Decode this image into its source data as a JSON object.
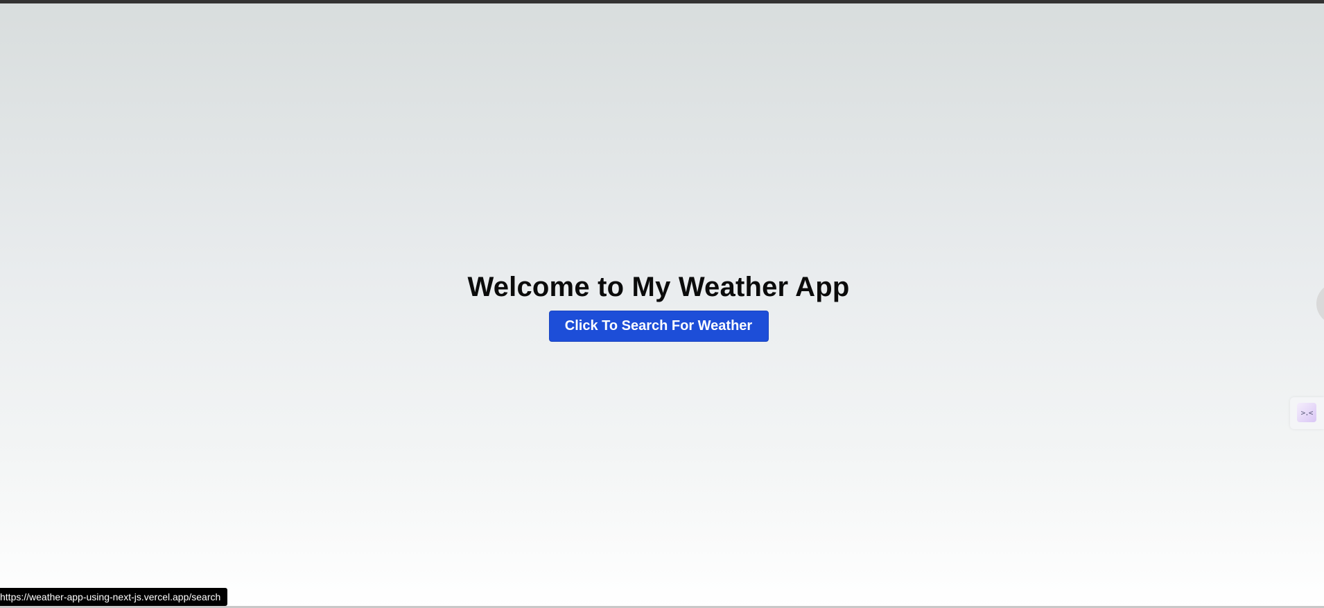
{
  "hero": {
    "title": "Welcome to My Weather App",
    "button_label": "Click To Search For Weather"
  },
  "status_bar": {
    "url": "https://weather-app-using-next-js.vercel.app/search"
  },
  "edge_widget": {
    "glyph": ">.<"
  },
  "colors": {
    "button_bg": "#1d4ed8",
    "title_text": "#0b0b0b",
    "top_bar": "#333333"
  },
  "icons": {
    "edge_widget_icon": "extension-face-icon"
  }
}
